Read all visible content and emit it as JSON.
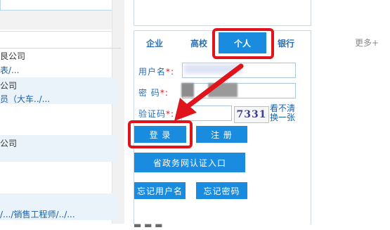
{
  "left": {
    "more_label": "更多+",
    "items": [
      "艮公司",
      "表/...",
      "公司",
      "员（大车../...",
      "公司",
      "/.../销售工程师/../..."
    ]
  },
  "login": {
    "tabs": {
      "enterprise": "企业",
      "university": "高校",
      "personal": "个人",
      "bank": "银行"
    },
    "fields": {
      "username_label": "用户名",
      "password_label": "密  码",
      "captcha_label": "验证码",
      "required_mark": "*:"
    },
    "captcha_text": "7331",
    "captcha_refresh": {
      "line1": "看不清",
      "line2": "换一张"
    },
    "buttons": {
      "login": "登 录",
      "register": "注 册",
      "gov_login": "省政务网认证入口",
      "forgot_username": "忘记用户名",
      "forgot_password": "忘记密码"
    }
  },
  "colors": {
    "accent_blue": "#1a8ce0",
    "highlight_red": "#e0141b",
    "link_blue": "#1760a8"
  }
}
